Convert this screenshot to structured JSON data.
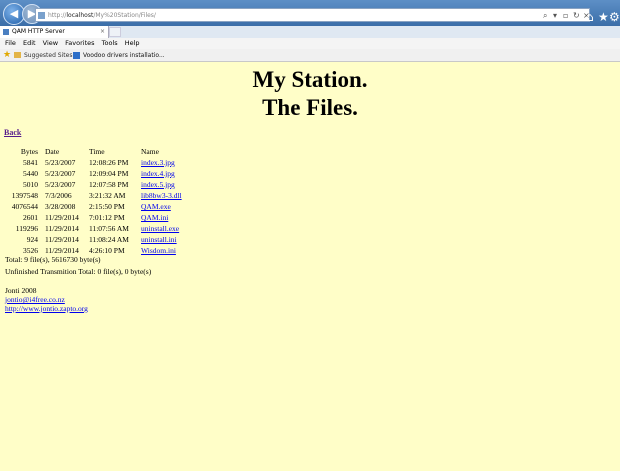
{
  "browser": {
    "address_url_prefix": "http://",
    "address_host": "localhost",
    "address_url_suffix": "/My%20Station/Files/",
    "tab_title": "QAM HTTP Server",
    "menu": [
      "File",
      "Edit",
      "View",
      "Favorites",
      "Tools",
      "Help"
    ],
    "favorites": [
      "Suggested Sites ▾",
      "Voodoo drivers installatio..."
    ]
  },
  "page": {
    "title_line1": "My Station.",
    "title_line2": "The Files.",
    "back_link": "Back",
    "headers": [
      "Bytes",
      "Date",
      "Time",
      "Name"
    ],
    "files": [
      {
        "bytes": "5841",
        "date": "5/23/2007",
        "time": "12:08:26 PM",
        "name": "index.3.jpg"
      },
      {
        "bytes": "5440",
        "date": "5/23/2007",
        "time": "12:09:04 PM",
        "name": "index.4.jpg"
      },
      {
        "bytes": "5010",
        "date": "5/23/2007",
        "time": "12:07:58 PM",
        "name": "index.5.jpg"
      },
      {
        "bytes": "1397548",
        "date": "7/3/2006",
        "time": "3:21:32 AM",
        "name": "lib8bw3-3.dll"
      },
      {
        "bytes": "4076544",
        "date": "3/28/2008",
        "time": "2:15:50 PM",
        "name": "QAM.exe"
      },
      {
        "bytes": "2601",
        "date": "11/29/2014",
        "time": "7:01:12 PM",
        "name": "QAM.ini"
      },
      {
        "bytes": "119296",
        "date": "11/29/2014",
        "time": "11:07:56 AM",
        "name": "uninstall.exe"
      },
      {
        "bytes": "924",
        "date": "11/29/2014",
        "time": "11:08:24 AM",
        "name": "uninstall.ini"
      },
      {
        "bytes": "3526",
        "date": "11/29/2014",
        "time": "4:26:10 PM",
        "name": "Wisdom.ini"
      }
    ],
    "total": "Total: 9 file(s), 5616730 byte(s)",
    "unfinished": "Unfinished Transmition Total: 0 file(s), 0 byte(s)",
    "footer_author": "Jonti 2008",
    "footer_email": "jontio@i4free.co.nz",
    "footer_url": "http://www.jontio.zapto.org"
  },
  "colors": {
    "page_bg": "#fffec8",
    "link": "#0000ee",
    "visited_link": "#551a8b",
    "titlebar": "#3b6ea8"
  }
}
